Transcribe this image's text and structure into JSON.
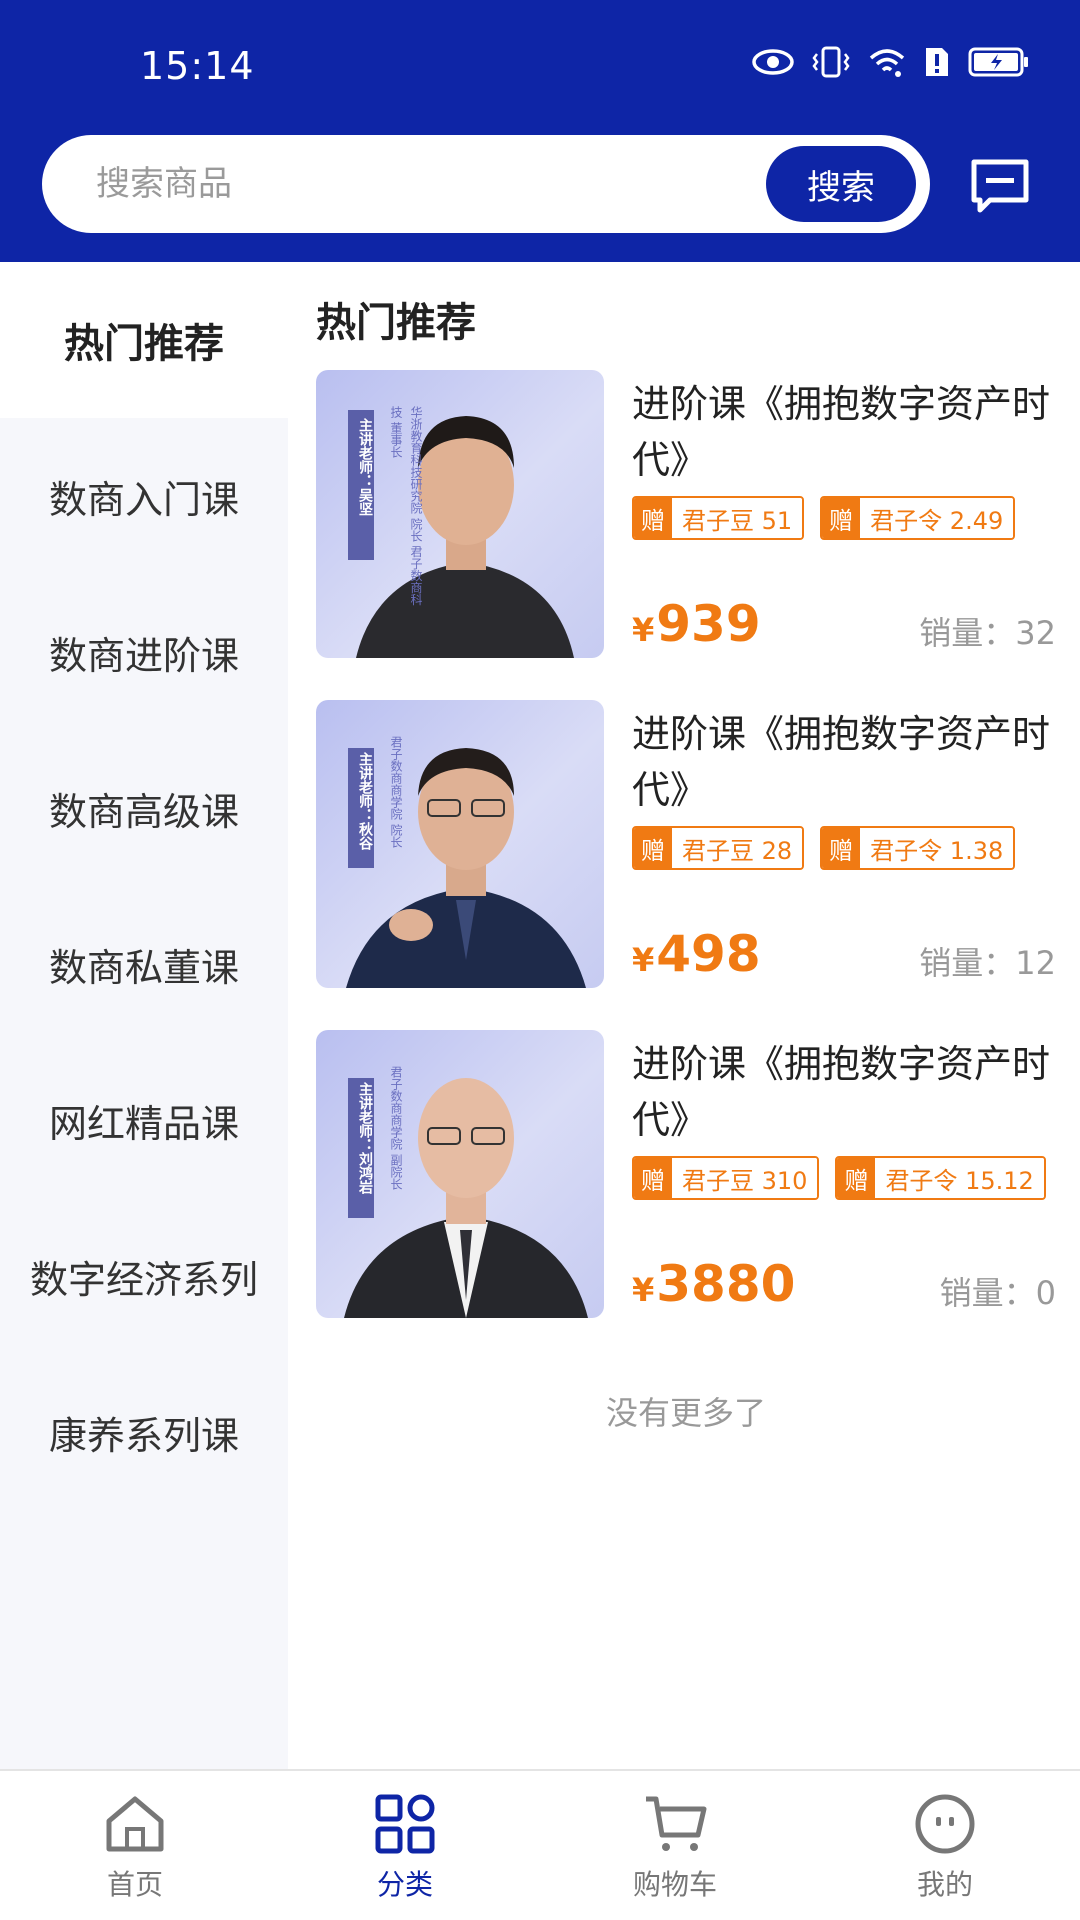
{
  "status_bar": {
    "time": "15:14"
  },
  "search": {
    "placeholder": "搜索商品",
    "button_label": "搜索"
  },
  "sidebar": {
    "items": [
      {
        "label": "热门推荐",
        "active": true
      },
      {
        "label": "数商入门课"
      },
      {
        "label": "数商进阶课"
      },
      {
        "label": "数商高级课"
      },
      {
        "label": "数商私董课"
      },
      {
        "label": "网红精品课"
      },
      {
        "label": "数字经济系列"
      },
      {
        "label": "康养系列课"
      }
    ]
  },
  "main": {
    "section_title": "热门推荐",
    "products": [
      {
        "title": "进阶课《拥抱数字资产时代》",
        "image_label": "主讲老师：吴坚",
        "image_caption": "华浙教育科技研究院 院长 君子数商科技 董事长",
        "tags": [
          {
            "gift": "赠",
            "text": "君子豆 51"
          },
          {
            "gift": "赠",
            "text": "君子令 2.49"
          }
        ],
        "currency": "¥",
        "price": "939",
        "sales_label": "销量：",
        "sales": "32"
      },
      {
        "title": "进阶课《拥抱数字资产时代》",
        "image_label": "主讲老师：秋谷",
        "image_caption": "君子数商商学院 院长",
        "tags": [
          {
            "gift": "赠",
            "text": "君子豆 28"
          },
          {
            "gift": "赠",
            "text": "君子令 1.38"
          }
        ],
        "currency": "¥",
        "price": "498",
        "sales_label": "销量：",
        "sales": "12"
      },
      {
        "title": "进阶课《拥抱数字资产时代》",
        "image_label": "主讲老师：刘鸿岩",
        "image_caption": "君子数商商学院 副院长",
        "tags": [
          {
            "gift": "赠",
            "text": "君子豆 310"
          },
          {
            "gift": "赠",
            "text": "君子令 15.12"
          }
        ],
        "currency": "¥",
        "price": "3880",
        "sales_label": "销量：",
        "sales": "0"
      }
    ],
    "no_more": "没有更多了"
  },
  "bottom_nav": {
    "items": [
      {
        "label": "首页",
        "icon": "home-icon"
      },
      {
        "label": "分类",
        "icon": "category-icon",
        "active": true
      },
      {
        "label": "购物车",
        "icon": "cart-icon"
      },
      {
        "label": "我的",
        "icon": "profile-icon"
      }
    ]
  },
  "colors": {
    "brand": "#0e25a6",
    "accent": "#f07a13",
    "sidebar_bg": "#f6f7fb"
  }
}
